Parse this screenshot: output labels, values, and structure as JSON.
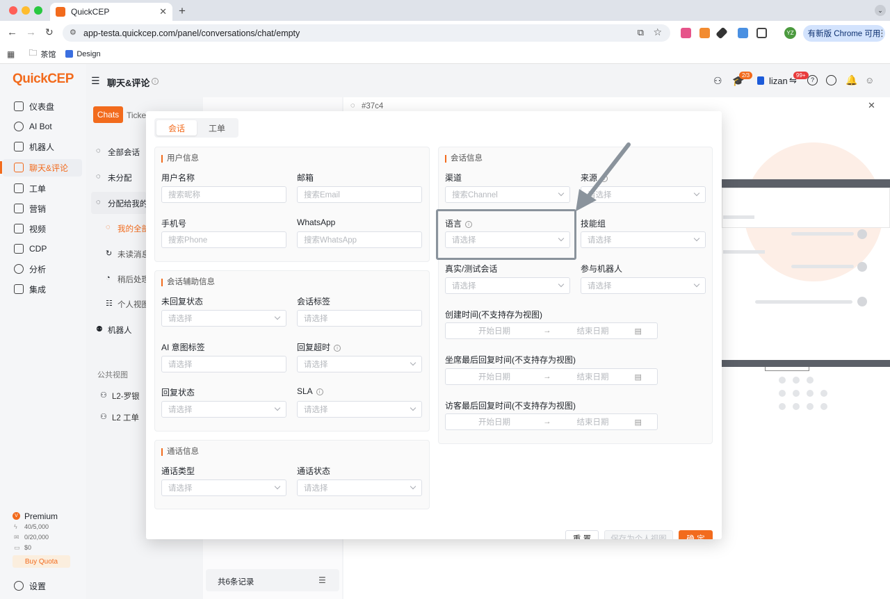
{
  "browser": {
    "tab_title": "QuickCEP",
    "url": "app-testa.quickcep.com/panel/conversations/chat/empty",
    "bookmarks": [
      "茶馆",
      "Design"
    ],
    "update_label": "有新版 Chrome 可用",
    "profile": "YZ"
  },
  "sidebar": {
    "logo": "QuickCEP",
    "items": [
      {
        "label": "仪表盘"
      },
      {
        "label": "AI Bot"
      },
      {
        "label": "机器人"
      },
      {
        "label": "聊天&评论"
      },
      {
        "label": "工单"
      },
      {
        "label": "营销"
      },
      {
        "label": "视频"
      },
      {
        "label": "CDP"
      },
      {
        "label": "分析"
      },
      {
        "label": "集成"
      }
    ],
    "plan": "Premium",
    "quota1": "40/5,000",
    "quota2": "0/20,000",
    "quota3": "$0",
    "buy": "Buy Quota",
    "settings": "设置"
  },
  "header": {
    "title": "聊天&评论",
    "badge_course": "2/3",
    "user": "lizan",
    "badge_notice": "99+"
  },
  "list": {
    "tab_chats": "Chats",
    "tab_tickets": "Ticket",
    "items": [
      "全部会话",
      "未分配",
      "分配给我的",
      "我的全部",
      "未读消息",
      "稍后处理",
      "个人视图",
      "机器人"
    ],
    "public_title": "公共视图",
    "public_items": [
      "L2-罗银",
      "L2 工单"
    ],
    "footer": "共6条记录"
  },
  "conversation": {
    "id": "#37c4"
  },
  "filter": {
    "tabs": [
      "会话",
      "工单"
    ],
    "user_info": {
      "title": "用户信息",
      "fields": [
        {
          "label": "用户名称",
          "placeholder": "搜索昵称"
        },
        {
          "label": "邮箱",
          "placeholder": "搜索Email"
        },
        {
          "label": "手机号",
          "placeholder": "搜索Phone"
        },
        {
          "label": "WhatsApp",
          "placeholder": "搜索WhatsApp"
        }
      ]
    },
    "aux_info": {
      "title": "会话辅助信息",
      "fields": [
        {
          "label": "未回复状态",
          "placeholder": "请选择"
        },
        {
          "label": "会话标签",
          "placeholder": "请选择"
        },
        {
          "label": "AI 意图标签",
          "placeholder": "请选择"
        },
        {
          "label": "回复超时",
          "placeholder": "请选择"
        },
        {
          "label": "回复状态",
          "placeholder": "请选择"
        },
        {
          "label": "SLA",
          "placeholder": "请选择"
        }
      ]
    },
    "call_info": {
      "title": "通话信息",
      "fields": [
        {
          "label": "通话类型",
          "placeholder": "请选择"
        },
        {
          "label": "通话状态",
          "placeholder": "请选择"
        }
      ]
    },
    "conv_info": {
      "title": "会话信息",
      "fields": [
        {
          "label": "渠道",
          "placeholder": "搜索Channel"
        },
        {
          "label": "来源",
          "placeholder": "请选择"
        },
        {
          "label": "语言",
          "placeholder": "请选择"
        },
        {
          "label": "技能组",
          "placeholder": "请选择"
        },
        {
          "label": "真实/测试会话",
          "placeholder": "请选择"
        },
        {
          "label": "参与机器人",
          "placeholder": "请选择"
        }
      ],
      "dates": [
        {
          "label": "创建时间(不支持存为视图)",
          "start": "开始日期",
          "end": "结束日期"
        },
        {
          "label": "坐席最后回复时间(不支持存为视图)",
          "start": "开始日期",
          "end": "结束日期"
        },
        {
          "label": "访客最后回复时间(不支持存为视图)",
          "start": "开始日期",
          "end": "结束日期"
        }
      ]
    },
    "buttons": {
      "reset": "重 置",
      "save": "保存为个人视图",
      "confirm": "确 定"
    }
  },
  "colors": {
    "accent": "#f26b1d"
  }
}
